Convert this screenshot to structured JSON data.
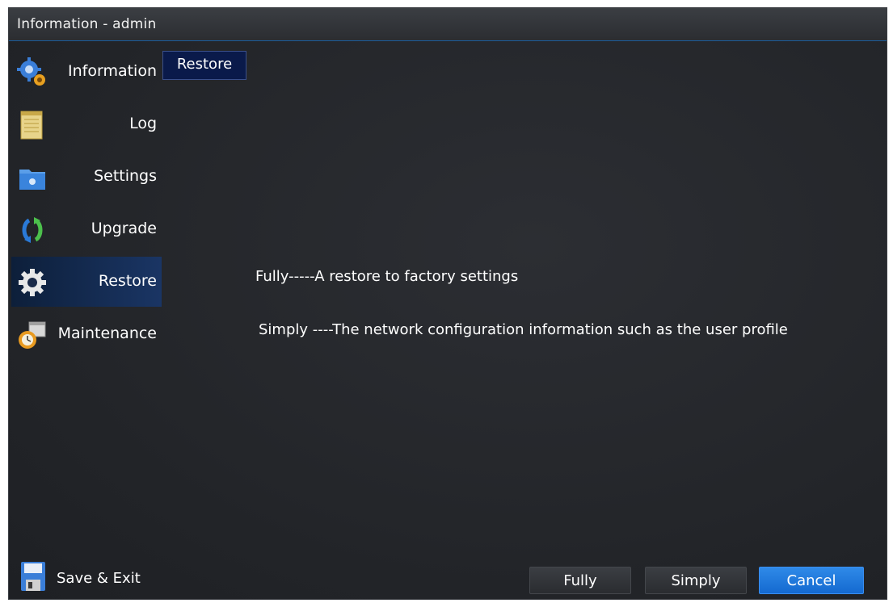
{
  "window": {
    "title": "Information - admin"
  },
  "sidebar": {
    "items": [
      {
        "label": "Information",
        "icon": "gears-icon"
      },
      {
        "label": "Log",
        "icon": "notepad-icon"
      },
      {
        "label": "Settings",
        "icon": "folder-settings-icon"
      },
      {
        "label": "Upgrade",
        "icon": "refresh-arrows-icon"
      },
      {
        "label": "Restore",
        "icon": "gear-icon",
        "active": true
      },
      {
        "label": "Maintenance",
        "icon": "clock-calendar-icon"
      }
    ],
    "save_exit": {
      "label": "Save & Exit",
      "icon": "floppy-disk-icon"
    }
  },
  "main": {
    "tab": {
      "label": "Restore"
    },
    "descriptions": [
      "Fully-----A restore to factory settings",
      "Simply ----The network configuration information such as the user profile"
    ]
  },
  "footer": {
    "buttons": {
      "fully": "Fully",
      "simply": "Simply",
      "cancel": "Cancel"
    }
  },
  "colors": {
    "background": "#24262a",
    "accent": "#1f78e0",
    "active_item": "#1a3564",
    "tab": "#0a1a4a"
  }
}
